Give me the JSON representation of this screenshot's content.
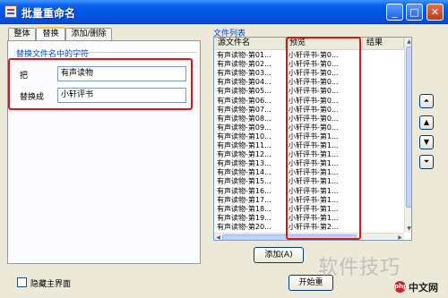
{
  "window": {
    "title": "批量重命名",
    "minimize_label": "_",
    "maximize_label": "□",
    "close_label": "✕"
  },
  "tabs": [
    {
      "label": "整体"
    },
    {
      "label": "替换"
    },
    {
      "label": "添加/删除"
    }
  ],
  "replace": {
    "group_label": "替换文件名中的字符",
    "find_label": "把",
    "find_value": "有声读物",
    "replace_label": "替换成",
    "replace_value": "小轩评书"
  },
  "filelist": {
    "caption": "文件列表",
    "columns": [
      "源文件名",
      "预览",
      "结果"
    ],
    "rows": [
      [
        "有声读物-第01...",
        "小轩评书-第0...",
        ""
      ],
      [
        "有声读物-第02...",
        "小轩评书-第0...",
        ""
      ],
      [
        "有声读物-第03...",
        "小轩评书-第0...",
        ""
      ],
      [
        "有声读物-第04...",
        "小轩评书-第0...",
        ""
      ],
      [
        "有声读物-第05...",
        "小轩评书-第0...",
        ""
      ],
      [
        "有声读物-第06...",
        "小轩评书-第0...",
        ""
      ],
      [
        "有声读物-第07...",
        "小轩评书-第0...",
        ""
      ],
      [
        "有声读物-第08...",
        "小轩评书-第0...",
        ""
      ],
      [
        "有声读物-第09...",
        "小轩评书-第0...",
        ""
      ],
      [
        "有声读物-第10...",
        "小轩评书-第1...",
        ""
      ],
      [
        "有声读物-第11...",
        "小轩评书-第1...",
        ""
      ],
      [
        "有声读物-第12...",
        "小轩评书-第1...",
        ""
      ],
      [
        "有声读物-第13...",
        "小轩评书-第1...",
        ""
      ],
      [
        "有声读物-第14...",
        "小轩评书-第1...",
        ""
      ],
      [
        "有声读物-第15...",
        "小轩评书-第1...",
        ""
      ],
      [
        "有声读物-第16...",
        "小轩评书-第1...",
        ""
      ],
      [
        "有声读物-第17...",
        "小轩评书-第1...",
        ""
      ],
      [
        "有声读物-第18...",
        "小轩评书-第1...",
        ""
      ],
      [
        "有声读物-第19...",
        "小轩评书-第1...",
        ""
      ],
      [
        "有声读物-第20...",
        "小轩评书-第2...",
        ""
      ]
    ]
  },
  "side_buttons": [
    {
      "icon": "move-to-top-icon",
      "glyph": "⏶"
    },
    {
      "icon": "move-up-icon",
      "glyph": "▲"
    },
    {
      "icon": "move-down-icon",
      "glyph": "▼"
    },
    {
      "icon": "move-to-bottom-icon",
      "glyph": "⏷"
    }
  ],
  "add_button": {
    "label": "添加(A)"
  },
  "hide_main": {
    "label": "隐藏主界面"
  },
  "start_button": {
    "label": "开始重"
  },
  "watermark": {
    "text": "软件技巧"
  },
  "logo": {
    "badge": "php",
    "text": "中文网"
  },
  "colors": {
    "title_bar": "#0054e3",
    "highlight_box": "#d11b1b",
    "window_bg": "#ece9d8"
  }
}
